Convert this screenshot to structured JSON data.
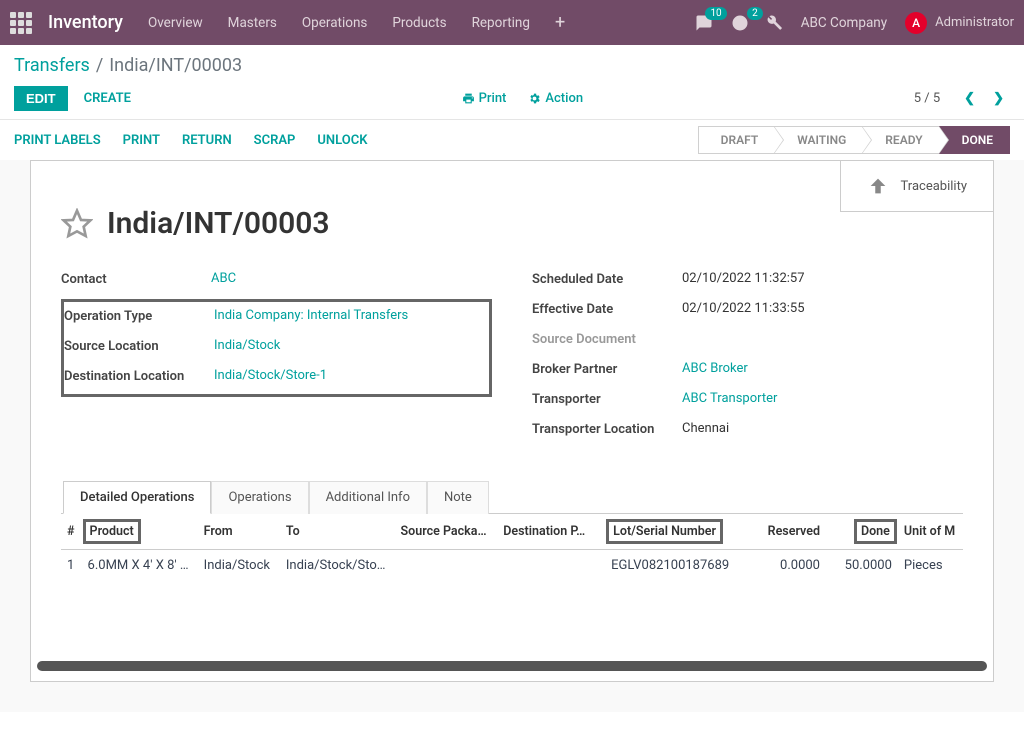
{
  "navbar": {
    "brand": "Inventory",
    "menus": [
      "Overview",
      "Masters",
      "Operations",
      "Products",
      "Reporting"
    ],
    "msg_badge": "10",
    "activity_badge": "2",
    "company": "ABC Company",
    "avatar_letter": "A",
    "user": "Administrator"
  },
  "breadcrumb": {
    "root": "Transfers",
    "current": "India/INT/00003"
  },
  "cp": {
    "edit": "EDIT",
    "create": "CREATE",
    "print": "Print",
    "action": "Action",
    "pager": "5 / 5"
  },
  "buttonbar": [
    "PRINT LABELS",
    "PRINT",
    "RETURN",
    "SCRAP",
    "UNLOCK"
  ],
  "status": [
    "DRAFT",
    "WAITING",
    "READY",
    "DONE"
  ],
  "stat_button": "Traceability",
  "title": "India/INT/00003",
  "left_fields": {
    "contact_label": "Contact",
    "contact_value": "ABC",
    "op_label": "Operation Type",
    "op_value": "India Company: Internal Transfers",
    "src_label": "Source Location",
    "src_value": "India/Stock",
    "dest_label": "Destination Location",
    "dest_value": "India/Stock/Store-1"
  },
  "right_fields": {
    "sched_label": "Scheduled Date",
    "sched_value": "02/10/2022 11:32:57",
    "eff_label": "Effective Date",
    "eff_value": "02/10/2022 11:33:55",
    "srcdoc_label": "Source Document",
    "broker_label": "Broker Partner",
    "broker_value": "ABC Broker",
    "trans_label": "Transporter",
    "trans_value": "ABC Transporter",
    "transloc_label": "Transporter Location",
    "transloc_value": "Chennai"
  },
  "tabs": [
    "Detailed Operations",
    "Operations",
    "Additional Info",
    "Note"
  ],
  "columns": {
    "num": "#",
    "product": "Product",
    "from": "From",
    "to": "To",
    "srcpack": "Source Packa…",
    "destpack": "Destination P…",
    "lot": "Lot/Serial Number",
    "reserved": "Reserved",
    "done": "Done",
    "uom": "Unit of M"
  },
  "row": {
    "num": "1",
    "product": "6.0MM X 4' X 8' …",
    "from": "India/Stock",
    "to": "India/Stock/Sto…",
    "srcpack": "",
    "destpack": "",
    "lot": "EGLV082100187689",
    "reserved": "0.0000",
    "done": "50.0000",
    "uom": "Pieces"
  }
}
